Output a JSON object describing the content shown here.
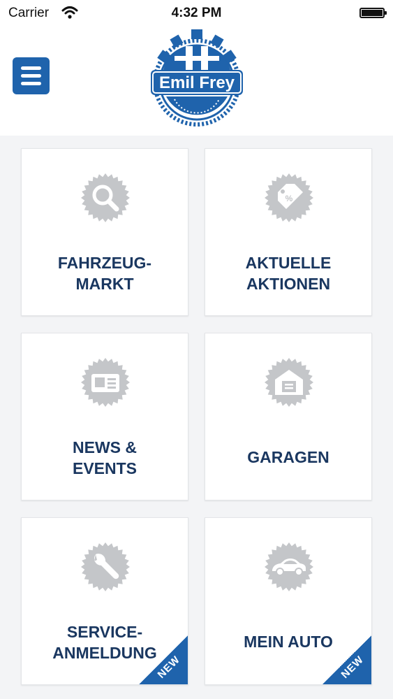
{
  "status_bar": {
    "carrier": "Carrier",
    "time": "4:32 PM"
  },
  "header": {
    "brand": "Emil Frey",
    "menu_icon": "hamburger-menu-icon"
  },
  "colors": {
    "brand_blue": "#1f63ac",
    "label_navy": "#1a3760",
    "icon_gray": "#c4c6c9",
    "background": "#f3f4f6"
  },
  "tiles": [
    {
      "id": "fahrzeugmarkt",
      "icon": "search-icon",
      "lines": [
        "FAHRZEUG-",
        "MARKT"
      ],
      "badge": ""
    },
    {
      "id": "aktuelle-aktionen",
      "icon": "price-tag-icon",
      "lines": [
        "AKTUELLE",
        "AKTIONEN"
      ],
      "badge": ""
    },
    {
      "id": "news-events",
      "icon": "newspaper-icon",
      "lines": [
        "NEWS &",
        "EVENTS"
      ],
      "badge": ""
    },
    {
      "id": "garagen",
      "icon": "garage-icon",
      "lines": [
        "GARAGEN"
      ],
      "badge": ""
    },
    {
      "id": "service-anmeldung",
      "icon": "wrench-icon",
      "lines": [
        "SERVICE-",
        "ANMELDUNG"
      ],
      "badge": "NEW"
    },
    {
      "id": "mein-auto",
      "icon": "car-icon",
      "lines": [
        "MEIN AUTO"
      ],
      "badge": "NEW"
    }
  ]
}
